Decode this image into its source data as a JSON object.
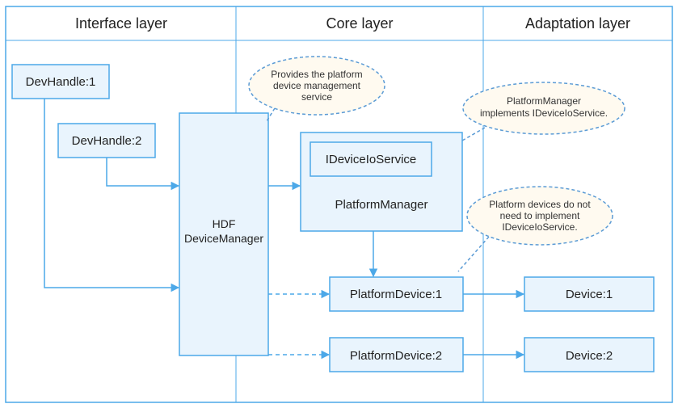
{
  "layers": {
    "interface": "Interface layer",
    "core": "Core layer",
    "adaptation": "Adaptation layer"
  },
  "nodes": {
    "devhandle1": "DevHandle:1",
    "devhandle2": "DevHandle:2",
    "hdf_mgr_l1": "HDF",
    "hdf_mgr_l2": "DeviceManager",
    "ideviceio": "IDeviceIoService",
    "platform_mgr": "PlatformManager",
    "platform_dev1": "PlatformDevice:1",
    "platform_dev2": "PlatformDevice:2",
    "device1": "Device:1",
    "device2": "Device:2"
  },
  "callouts": {
    "c1_l1": "Provides the platform",
    "c1_l2": "device management",
    "c1_l3": "service",
    "c2_l1": "PlatformManager",
    "c2_l2": "implements IDeviceIoService.",
    "c3_l1": "Platform devices do not",
    "c3_l2": "need to implement",
    "c3_l3": "IDeviceIoService."
  }
}
